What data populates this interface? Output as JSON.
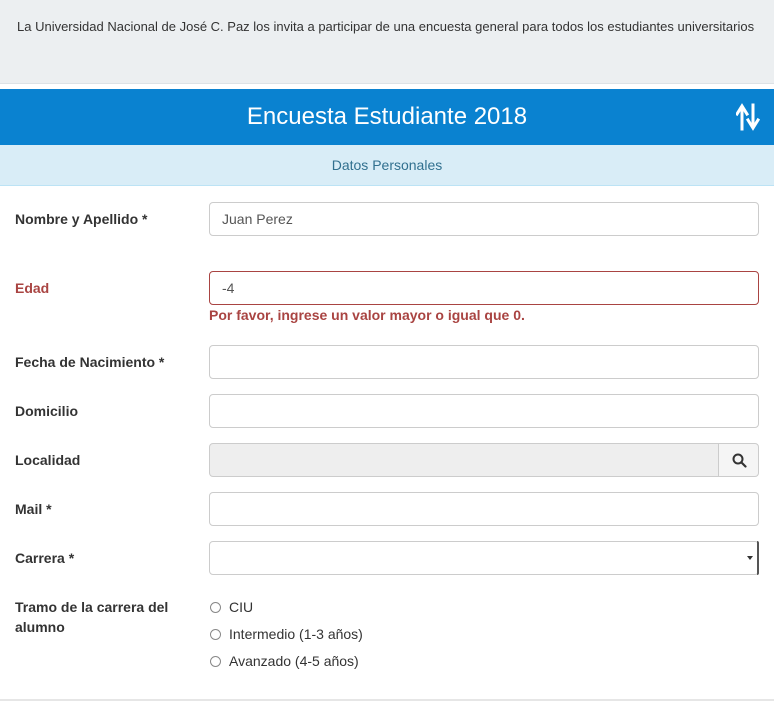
{
  "intro": {
    "text": "La Universidad Nacional de José C. Paz los  invita a participar de una encuesta general para todos los estudiantes universitarios"
  },
  "header": {
    "title": "Encuesta Estudiante 2018",
    "icon": "sort-arrows-icon"
  },
  "section": {
    "title": "Datos Personales"
  },
  "form": {
    "nombre": {
      "label": "Nombre y Apellido *",
      "value": "Juan Perez"
    },
    "edad": {
      "label": "Edad",
      "value": "-4",
      "error": "Por favor, ingrese un valor mayor o igual que 0."
    },
    "fecha": {
      "label": "Fecha de Nacimiento *",
      "value": ""
    },
    "domicilio": {
      "label": "Domicilio",
      "value": ""
    },
    "localidad": {
      "label": "Localidad",
      "value": "",
      "button_icon": "search-icon"
    },
    "mail": {
      "label": "Mail *",
      "value": ""
    },
    "carrera": {
      "label": "Carrera *",
      "value": ""
    },
    "tramo": {
      "label": "Tramo de la carrera del alumno",
      "options": [
        "CIU",
        "Intermedio (1-3 años)",
        "Avanzado (4-5 años)"
      ]
    }
  },
  "colors": {
    "header_bg": "#0a82d0",
    "section_bg": "#d9edf7",
    "error": "#a94442"
  }
}
